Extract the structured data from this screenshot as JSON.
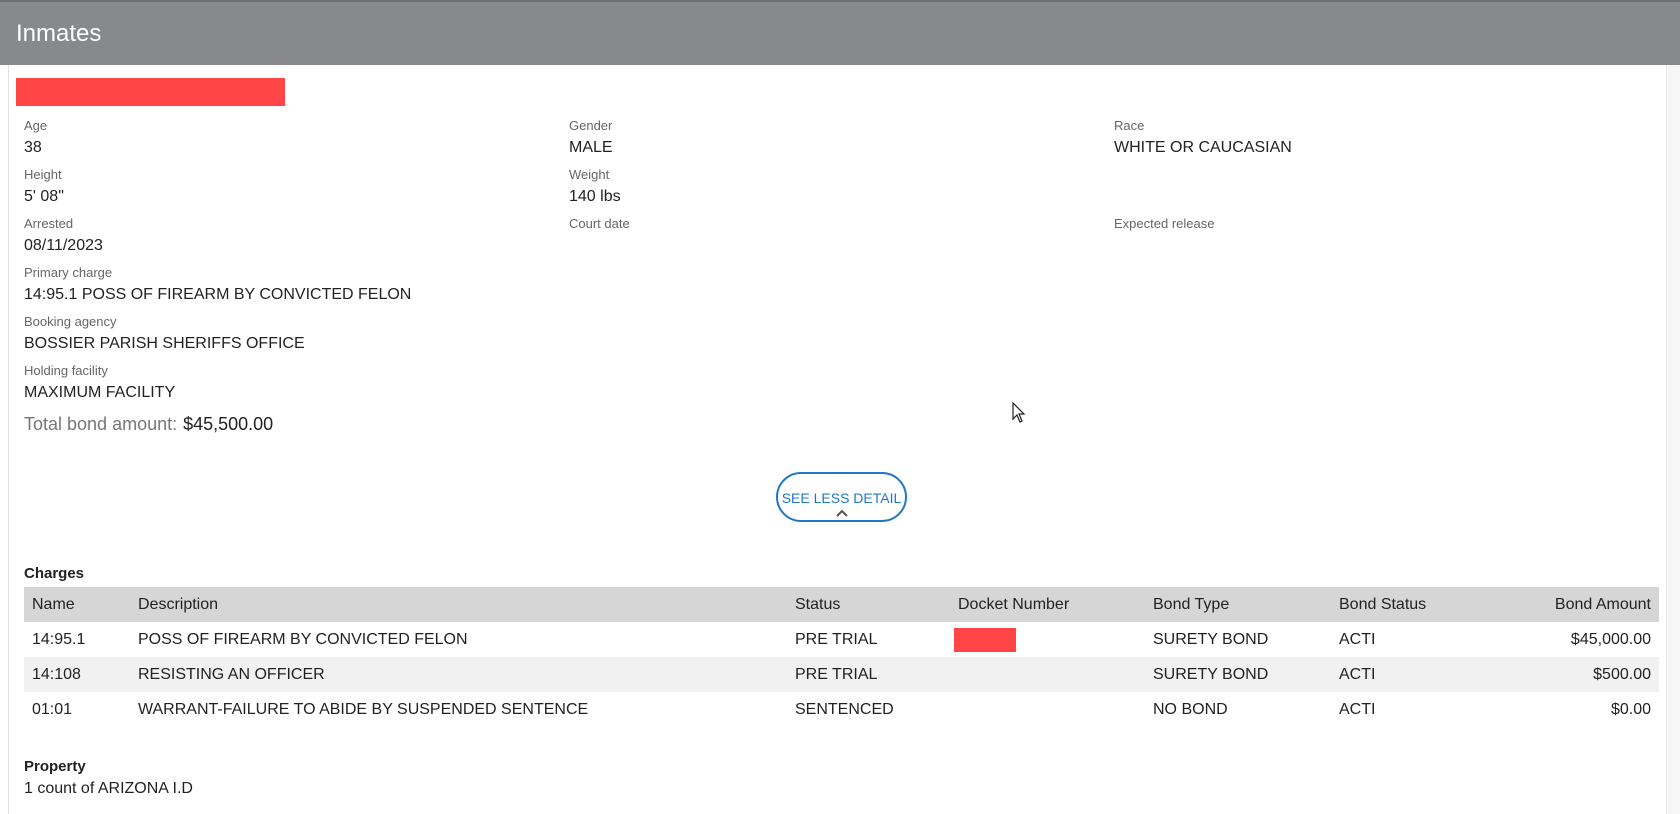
{
  "header": {
    "title": "Inmates"
  },
  "inmate": {
    "age_label": "Age",
    "age": "38",
    "gender_label": "Gender",
    "gender": "MALE",
    "race_label": "Race",
    "race": "WHITE OR CAUCASIAN",
    "height_label": "Height",
    "height": "5' 08\"",
    "weight_label": "Weight",
    "weight": "140 lbs",
    "arrested_label": "Arrested",
    "arrested": "08/11/2023",
    "court_date_label": "Court date",
    "court_date": "",
    "expected_release_label": "Expected release",
    "expected_release": "",
    "primary_charge_label": "Primary charge",
    "primary_charge": "14:95.1 POSS OF FIREARM BY CONVICTED FELON",
    "booking_agency_label": "Booking agency",
    "booking_agency": "BOSSIER PARISH SHERIFFS OFFICE",
    "holding_facility_label": "Holding facility",
    "holding_facility": "MAXIMUM FACILITY",
    "total_bond_label": "Total bond amount:",
    "total_bond": "$45,500.00"
  },
  "see_less_button": {
    "label": "SEE LESS DETAIL"
  },
  "charges": {
    "title": "Charges",
    "columns": [
      "Name",
      "Description",
      "Status",
      "Docket Number",
      "Bond Type",
      "Bond Status",
      "Bond Amount"
    ],
    "rows": [
      {
        "name": "14:95.1",
        "description": "POSS OF FIREARM BY CONVICTED FELON",
        "status": "PRE TRIAL",
        "docket": "",
        "bond_type": "SURETY BOND",
        "bond_status": "ACTI",
        "bond_amount": "$45,000.00"
      },
      {
        "name": "14:108",
        "description": "RESISTING AN OFFICER",
        "status": "PRE TRIAL",
        "docket": "",
        "bond_type": "SURETY BOND",
        "bond_status": "ACTI",
        "bond_amount": "$500.00"
      },
      {
        "name": "01:01",
        "description": "WARRANT-FAILURE TO ABIDE BY SUSPENDED SENTENCE",
        "status": "SENTENCED",
        "docket": "",
        "bond_type": "NO BOND",
        "bond_status": "ACTI",
        "bond_amount": "$0.00"
      }
    ]
  },
  "property": {
    "title": "Property",
    "items": [
      "1 count of ARIZONA I.D"
    ]
  },
  "colors": {
    "header_bg": "#88898b",
    "accent": "#1f77c8",
    "redaction": "#ff4545",
    "table_header_bg": "#d6d6d6",
    "row_alt_bg": "#f1f1f1"
  },
  "icons": {
    "chevron": "chevron-up-icon",
    "cursor": "mouse-pointer-icon"
  }
}
